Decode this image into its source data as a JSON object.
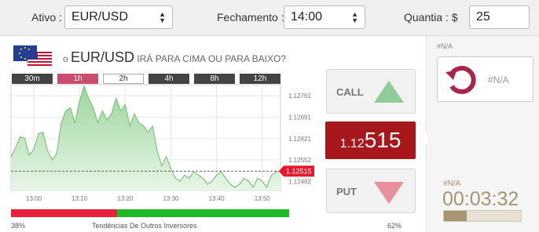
{
  "toolbar": {
    "asset_label": "Ativo :",
    "asset_value": "EUR/USD",
    "expiry_label": "Fechamento :",
    "expiry_value": "14:00",
    "amount_label": "Quantia : $",
    "amount_value": "25"
  },
  "question": {
    "prefix": "o",
    "asset": "EUR/USD",
    "suffix": "IRÁ PARA CIMA OU PARA BAIXO?"
  },
  "timeframes": [
    {
      "label": "30m",
      "state": "normal"
    },
    {
      "label": "1h",
      "state": "active"
    },
    {
      "label": "2h",
      "state": "selected"
    },
    {
      "label": "4h",
      "state": "normal"
    },
    {
      "label": "8h",
      "state": "normal"
    },
    {
      "label": "12h",
      "state": "normal"
    }
  ],
  "chart_data": {
    "type": "area",
    "x": [
      "12:55",
      "12:56",
      "12:57",
      "12:58",
      "12:59",
      "13:00",
      "13:01",
      "13:02",
      "13:03",
      "13:04",
      "13:05",
      "13:06",
      "13:07",
      "13:08",
      "13:09",
      "13:10",
      "13:11",
      "13:12",
      "13:13",
      "13:14",
      "13:15",
      "13:16",
      "13:17",
      "13:18",
      "13:19",
      "13:20",
      "13:21",
      "13:22",
      "13:23",
      "13:24",
      "13:25",
      "13:26",
      "13:27",
      "13:28",
      "13:29",
      "13:30",
      "13:31",
      "13:32",
      "13:33",
      "13:34",
      "13:35",
      "13:36",
      "13:37",
      "13:38",
      "13:39",
      "13:40",
      "13:41",
      "13:42",
      "13:43",
      "13:44",
      "13:45",
      "13:46",
      "13:47",
      "13:48",
      "13:49",
      "13:50",
      "13:51",
      "13:52",
      "13:53",
      "13:54"
    ],
    "values": [
      1.12562,
      1.12592,
      1.12627,
      1.12622,
      1.12567,
      1.12587,
      1.12637,
      1.12642,
      1.12582,
      1.12552,
      1.12572,
      1.12672,
      1.12712,
      1.12722,
      1.12672,
      1.12742,
      1.12792,
      1.12752,
      1.12722,
      1.12672,
      1.12712,
      1.12682,
      1.12702,
      1.12752,
      1.12712,
      1.12732,
      1.12662,
      1.12702,
      1.12672,
      1.12662,
      1.12642,
      1.12662,
      1.12582,
      1.12532,
      1.12562,
      1.12522,
      1.12492,
      1.12482,
      1.12502,
      1.12492,
      1.12512,
      1.12502,
      1.12492,
      1.12472,
      1.12482,
      1.12502,
      1.12512,
      1.12492,
      1.12472,
      1.12462,
      1.12472,
      1.12492,
      1.12482,
      1.12462,
      1.12492,
      1.12482,
      1.12462,
      1.12502,
      1.12512,
      1.12515
    ],
    "y_ticks": [
      "1.12761",
      "1.12691",
      "1.12621",
      "1.12552",
      "1.12482"
    ],
    "y_tick_values": [
      1.12761,
      1.12691,
      1.12621,
      1.12552,
      1.12482
    ],
    "x_ticks": [
      "13:00",
      "13:10",
      "13:20",
      "13:30",
      "13:40",
      "13:50"
    ],
    "current_value": 1.12515,
    "current_label": "1.12515",
    "ylim": [
      1.12452,
      1.12797
    ],
    "grid": true,
    "colors": {
      "line": "#6bbf6b",
      "fill_top": "#9ed59e",
      "fill_bottom": "#e7f5e7",
      "marker": "#e8172c"
    }
  },
  "sentiment": {
    "put_pct": 38,
    "left_label": "38%",
    "center_label": "Tendências De Outros Inversores",
    "right_label": "62%",
    "colors": {
      "put": "#ec1f3b",
      "call": "#1dbb26"
    }
  },
  "trade": {
    "call_label": "CALL",
    "put_label": "PUT",
    "price_small": "1.12",
    "price_big": "515"
  },
  "sidebar": {
    "rollover_top_label": "#N/A",
    "rollover_label": "#N/A",
    "timer_label": "#N/A",
    "timer_value": "00:03:32",
    "timer_progress_pct": 30
  },
  "colors": {
    "accent_red": "#a8171c",
    "accent_gold": "#a59570",
    "rollover_icon": "#a8264a"
  }
}
